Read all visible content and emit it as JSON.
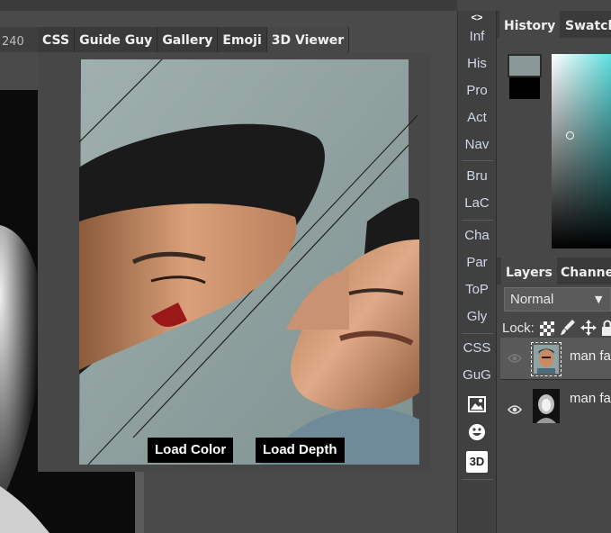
{
  "ruler": {
    "label": "240"
  },
  "tabs": [
    {
      "label": "CSS",
      "active": false
    },
    {
      "label": "Guide Guy",
      "active": false
    },
    {
      "label": "Gallery",
      "active": false
    },
    {
      "label": "Emoji",
      "active": false
    },
    {
      "label": "3D Viewer",
      "active": true
    }
  ],
  "viewer": {
    "load_color": "Load Color",
    "load_depth": "Load Depth"
  },
  "iconbar": {
    "toggle": "<>",
    "items": [
      "Inf",
      "His",
      "Pro",
      "Act",
      "Nav",
      "Bru",
      "LaC",
      "Cha",
      "Par",
      "ToP",
      "Gly",
      "CSS",
      "GuG"
    ],
    "three_d": "3D"
  },
  "history_panel": {
    "tabs": [
      "History",
      "Swatches"
    ],
    "foreground": "#8a9898",
    "background": "#000000"
  },
  "layers_panel": {
    "tabs": [
      "Layers",
      "Channels"
    ],
    "blend_mode": "Normal",
    "lock_label": "Lock:",
    "layers": [
      {
        "name": "man face",
        "visible": true,
        "selected": true
      },
      {
        "name": "man face depth",
        "visible": true,
        "selected": false
      }
    ]
  },
  "colors": {
    "accent_active_tab": "#474747",
    "ui_dark": "#3a3a3a",
    "text": "#e6e6e6"
  }
}
